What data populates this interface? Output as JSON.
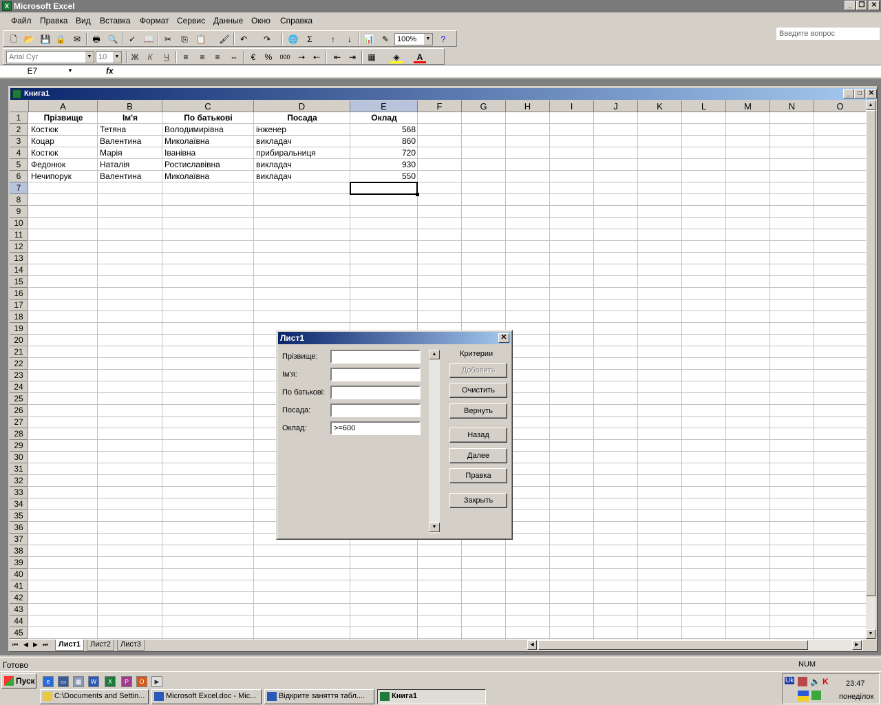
{
  "app": {
    "title": "Microsoft Excel"
  },
  "menu": [
    "Файл",
    "Правка",
    "Вид",
    "Вставка",
    "Формат",
    "Сервис",
    "Данные",
    "Окно",
    "Справка"
  ],
  "ask_placeholder": "Введите вопрос",
  "toolbar": {
    "zoom": "100%",
    "font": "Arial Cyr",
    "font_size": "10",
    "bold_label": "Ж",
    "italic_label": "К",
    "underline_label": "Ч",
    "percent_label": "%",
    "thousands_label": "000"
  },
  "formula": {
    "namebox": "E7",
    "fx": "fx",
    "content": ""
  },
  "workbook": {
    "title": "Книга1"
  },
  "columns": [
    "A",
    "B",
    "C",
    "D",
    "E",
    "F",
    "G",
    "H",
    "I",
    "J",
    "K",
    "L",
    "M",
    "N",
    "O"
  ],
  "rows": [
    "1",
    "2",
    "3",
    "4",
    "5",
    "6",
    "7",
    "8",
    "9",
    "10",
    "11",
    "12",
    "13",
    "14",
    "15",
    "16",
    "17",
    "18",
    "19",
    "20",
    "21",
    "22",
    "23",
    "24",
    "25",
    "26",
    "27",
    "28",
    "29",
    "30",
    "31",
    "32",
    "33",
    "34",
    "35",
    "36",
    "37",
    "38",
    "39",
    "40",
    "41",
    "42",
    "43",
    "44",
    "45"
  ],
  "table": {
    "headers": [
      "Прізвище",
      "Ім'я",
      "По батькові",
      "Посада",
      "Оклад"
    ],
    "rows": [
      [
        "Костюк",
        "Тетяна",
        "Володимирівна",
        "інженер",
        "568"
      ],
      [
        "Коцар",
        "Валентина",
        "Миколаївна",
        "викладач",
        "860"
      ],
      [
        "Костюк",
        "Марія",
        "Іванівна",
        "прибиральниця",
        "720"
      ],
      [
        "Федонюк",
        "Наталія",
        "Ростиславівна",
        "викладач",
        "930"
      ],
      [
        "Нечипорук",
        "Валентина",
        "Миколаївна",
        "викладач",
        "550"
      ]
    ]
  },
  "sheets": [
    "Лист1",
    "Лист2",
    "Лист3"
  ],
  "status": {
    "ready": "Готово",
    "num": "NUM"
  },
  "dialog": {
    "title": "Лист1",
    "criteria_label": "Критерии",
    "fields": [
      {
        "label": "Прізвище:",
        "value": ""
      },
      {
        "label": "Ім'я:",
        "value": ""
      },
      {
        "label": "По батькові:",
        "value": ""
      },
      {
        "label": "Посада:",
        "value": ""
      },
      {
        "label": "Оклад:",
        "value": ">=600"
      }
    ],
    "buttons": {
      "add": "Добавить",
      "clear": "Очистить",
      "restore": "Вернуть",
      "prev": "Назад",
      "next": "Далее",
      "edit": "Правка",
      "close": "Закрыть"
    }
  },
  "taskbar": {
    "start": "Пуск",
    "tasks": [
      "C:\\Documents and Settin...",
      "Microsoft Excel.doc - Mic...",
      "Відкрите заняття табл....",
      "Книга1"
    ],
    "lang": "Uk",
    "time": "23:47",
    "day": "понеділок"
  }
}
